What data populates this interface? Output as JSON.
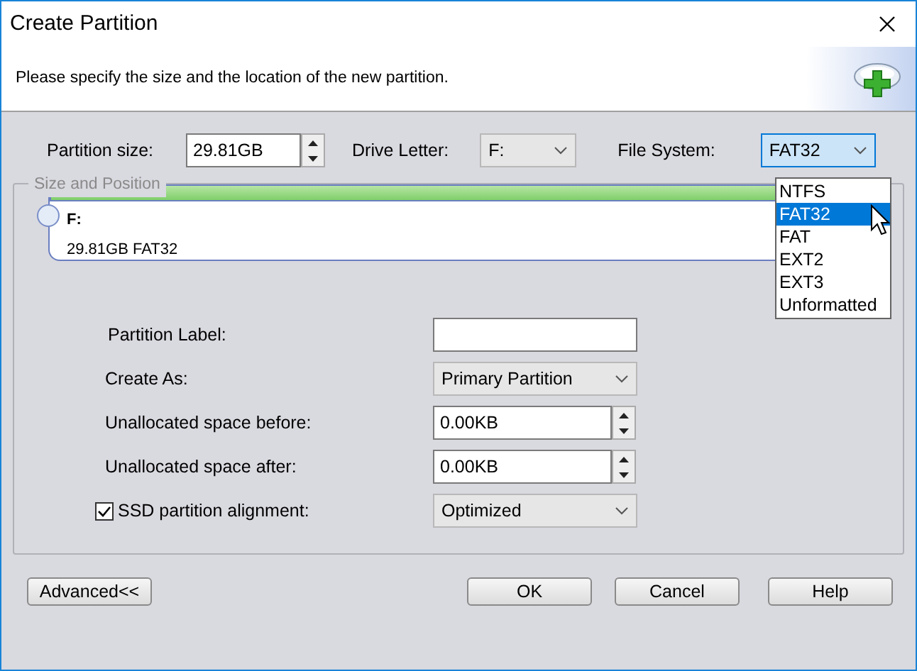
{
  "window": {
    "title": "Create Partition"
  },
  "header": {
    "text": "Please specify the size and the location of the new partition."
  },
  "partition_size": {
    "label": "Partition size:",
    "value": "29.81GB"
  },
  "drive_letter": {
    "label": "Drive Letter:",
    "value": "F:"
  },
  "file_system": {
    "label": "File System:",
    "value": "FAT32",
    "expanded": true,
    "options": [
      {
        "label": "NTFS",
        "selected": false
      },
      {
        "label": "FAT32",
        "selected": true
      },
      {
        "label": "FAT",
        "selected": false
      },
      {
        "label": "EXT2",
        "selected": false
      },
      {
        "label": "EXT3",
        "selected": false
      },
      {
        "label": "Unformatted",
        "selected": false
      }
    ]
  },
  "size_and_position": {
    "legend": "Size and Position",
    "partition": {
      "letter": "F:",
      "details": "29.81GB FAT32"
    }
  },
  "fields": [
    {
      "kind": "text",
      "label": "Partition Label:"
    },
    {
      "kind": "select",
      "label": "Create As:",
      "value": "Primary Partition"
    },
    {
      "kind": "spin",
      "label": "Unallocated space before:",
      "value": "0.00KB"
    },
    {
      "kind": "spin",
      "label": "Unallocated space after:",
      "value": "0.00KB"
    },
    {
      "kind": "check-select",
      "label": "SSD partition alignment:",
      "value": "Optimized",
      "checked": true
    }
  ],
  "buttons": [
    {
      "label": "Advanced<<",
      "kind": "left"
    },
    {
      "label": "OK",
      "kind": "right"
    },
    {
      "label": "Cancel",
      "kind": "right"
    },
    {
      "label": "Help",
      "kind": "right"
    }
  ]
}
